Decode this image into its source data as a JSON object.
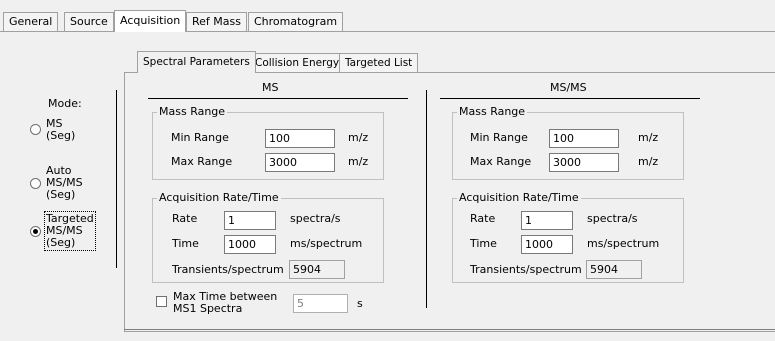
{
  "tabs": [
    "General",
    "Source",
    "Acquisition",
    "Ref Mass",
    "Chromatogram"
  ],
  "subtabs": [
    "Spectral Parameters",
    "Collision Energy",
    "Targeted List"
  ],
  "mode": {
    "label": "Mode:",
    "options": [
      {
        "label": "MS\n(Seg)",
        "checked": false
      },
      {
        "label": "Auto\nMS/MS\n(Seg)",
        "checked": false
      },
      {
        "label": "Targeted\nMS/MS\n(Seg)",
        "checked": true
      }
    ]
  },
  "ms": {
    "title": "MS",
    "mass_range_label": "Mass Range",
    "min_label": "Min Range",
    "min_value": "100",
    "max_label": "Max Range",
    "max_value": "3000",
    "unit_mz": "m/z",
    "acq_label": "Acquisition Rate/Time",
    "rate_label": "Rate",
    "rate_value": "1",
    "rate_unit": "spectra/s",
    "time_label": "Time",
    "time_value": "1000",
    "time_unit": "ms/spectrum",
    "transients_label": "Transients/spectrum",
    "transients_value": "5904"
  },
  "msms": {
    "title": "MS/MS",
    "mass_range_label": "Mass Range",
    "min_label": "Min Range",
    "min_value": "100",
    "max_label": "Max Range",
    "max_value": "3000",
    "unit_mz": "m/z",
    "acq_label": "Acquisition Rate/Time",
    "rate_label": "Rate",
    "rate_value": "1",
    "rate_unit": "spectra/s",
    "time_label": "Time",
    "time_value": "1000",
    "time_unit": "ms/spectrum",
    "transients_label": "Transients/spectrum",
    "transients_value": "5904"
  },
  "max_time": {
    "label": "Max Time between\nMS1 Spectra",
    "value": "5",
    "unit": "s",
    "checked": false
  }
}
